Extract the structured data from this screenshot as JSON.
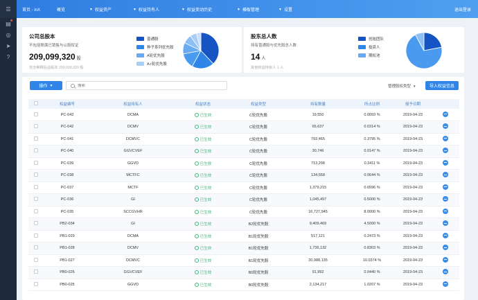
{
  "topbar": {
    "brand": "首页 - inX",
    "nav": [
      "概览",
      "权益资产",
      "权益持有人",
      "权益变动历史",
      "横板管理",
      "设置"
    ],
    "nav_carets": [
      false,
      true,
      true,
      true,
      true,
      true
    ],
    "logout": "退出登录"
  },
  "capital": {
    "title": "公司总股本",
    "subtitle": "不包括账面已销售与认股权证",
    "value": "209,099,320",
    "unit": "股",
    "footnote": "完全稀释后总股本 209,099,320 股",
    "legend": [
      {
        "label": "普通股",
        "color": "#1554c2"
      },
      {
        "label": "种子系列优先股",
        "color": "#2f86e8"
      },
      {
        "label": "A轮优先股",
        "color": "#6aaaf2"
      },
      {
        "label": "A+轮优先股",
        "color": "#a9cdf7"
      }
    ],
    "pie": [
      38,
      20,
      14,
      10,
      8,
      6,
      4
    ]
  },
  "holders": {
    "title": "股东总人数",
    "subtitle": "持有普通股与优先股总人数",
    "value": "14",
    "unit": "人",
    "footnote": "其他权益持有人 1 人",
    "legend": [
      {
        "label": "创始团队",
        "color": "#1554c2"
      },
      {
        "label": "投资人",
        "color": "#2f86e8"
      },
      {
        "label": "期权池",
        "color": "#6aaaf2"
      }
    ],
    "pie": [
      22,
      70,
      8
    ]
  },
  "toolbar": {
    "ops_label": "操作",
    "search_placeholder": "搜索",
    "sort_label": "管理股权类型",
    "import_label": "导入权益信息"
  },
  "table": {
    "headers": [
      "权益编号",
      "权益持有人",
      "权益状态",
      "权益类型",
      "持有数量",
      "所占比例",
      "授予日期"
    ],
    "rows": [
      [
        "PC-043",
        "DCMA",
        "已生效",
        "C轮优先股",
        "19,550",
        "0.0093 %",
        "2019-04-23"
      ],
      [
        "PC-042",
        "DCMV",
        "已生效",
        "C轮优先股",
        "65,637",
        "0.0314 %",
        "2019-04-23"
      ],
      [
        "PC-041",
        "DCMVC",
        "已生效",
        "C轮优先股",
        "793,465",
        "0.3795 %",
        "2019-04-23"
      ],
      [
        "PC-040",
        "GGVCVEF",
        "已生效",
        "C轮优先股",
        "30,746",
        "0.0147 %",
        "2019-04-23"
      ],
      [
        "PC-039",
        "GGVD",
        "已生效",
        "C轮优先股",
        "713,298",
        "0.3411 %",
        "2019-04-23"
      ],
      [
        "PC-038",
        "MCTFC",
        "已生效",
        "C轮优先股",
        "134,558",
        "0.0644 %",
        "2019-04-23"
      ],
      [
        "PC-037",
        "MCTF",
        "已生效",
        "C轮优先股",
        "1,379,215",
        "0.6596 %",
        "2019-04-23"
      ],
      [
        "PC-036",
        "GI",
        "已生效",
        "C轮优先股",
        "1,045,497",
        "0.5000 %",
        "2019-04-23"
      ],
      [
        "PC-035",
        "SCCGVHR",
        "已生效",
        "C轮优先股",
        "16,727,945",
        "8.0000 %",
        "2019-04-23"
      ],
      [
        "PB2-034",
        "GI",
        "已生效",
        "B2轮优先股",
        "9,409,469",
        "4.5000 %",
        "2019-04-23"
      ],
      [
        "PB1-029",
        "DCMA",
        "已生效",
        "B1轮优先股",
        "517,121",
        "0.2473 %",
        "2019-04-23"
      ],
      [
        "PB1-028",
        "DCMV",
        "已生效",
        "B1轮优先股",
        "1,736,132",
        "0.8303 %",
        "2019-04-23"
      ],
      [
        "PB1-027",
        "DCMVC",
        "已生效",
        "B1轮优先股",
        "20,988,135",
        "10.0374 %",
        "2019-04-23"
      ],
      [
        "PB0-026",
        "GGVCVEF",
        "已生效",
        "B0轮优先股",
        "91,992",
        "0.0440 %",
        "2019-04-23"
      ],
      [
        "PB0-025",
        "GGVD",
        "已生效",
        "B0轮优先股",
        "2,134,217",
        "1.0207 %",
        "2019-04-23"
      ]
    ]
  }
}
